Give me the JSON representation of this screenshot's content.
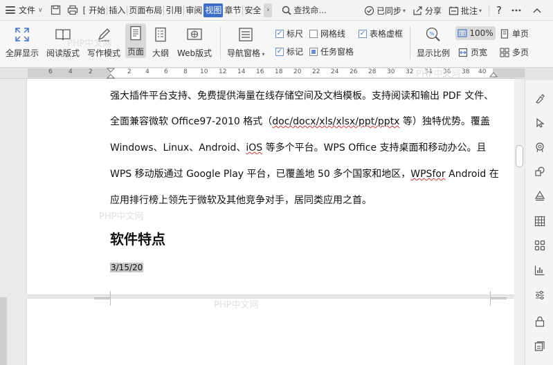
{
  "menu": {
    "file_label": "文件",
    "tabs": [
      "[",
      "开始",
      "插入",
      "页面布局",
      "引用",
      "审阅",
      "视图",
      "章节",
      "安全"
    ],
    "active_tab": "视图",
    "search_label": "查找命...",
    "sync_label": "已同步",
    "share_label": "分享",
    "comment_label": "批注",
    "help_label": "?"
  },
  "ribbon": {
    "fullscreen": "全屏显示",
    "read_mode": "阅读版式",
    "write_mode": "写作模式",
    "page_view": "页面",
    "outline": "大纲",
    "web_view": "Web版式",
    "nav_pane": "导航窗格",
    "ruler": "标尺",
    "gridlines": "网格线",
    "table_lines": "表格虚框",
    "marks": "标记",
    "task_pane": "任务窗格",
    "zoom_ratio": "显示比例",
    "zoom_value": "100%",
    "page_width": "页宽",
    "single_page": "单页",
    "multi_page": "多页"
  },
  "ruler_numbers": [
    "6",
    "4",
    "2",
    "2",
    "4",
    "6",
    "8",
    "10",
    "12",
    "14",
    "16",
    "18",
    "20",
    "22",
    "24",
    "26",
    "28",
    "30",
    "32",
    "34",
    "36",
    "38",
    "40"
  ],
  "document": {
    "lines": [
      "强大插件平台支持、免费提供海量在线存储空间及文档模板。支持阅读和输出 PDF 文件、",
      "全面兼容微软 Office97-2010 格式（doc/docx/xls/xlsx/ppt/pptx 等）独特优势。覆盖",
      "Windows、Linux、Android、iOS 等多个平台。WPS Office 支持桌面和移动办公。且",
      "WPS 移动版通过 Google Play 平台，已覆盖地 50 多个国家和地区，WPSfor Android 在",
      "应用排行榜上领先于微软及其他竞争对手，居同类应用之首。"
    ],
    "heading": "软件特点",
    "date": "3/15/20"
  },
  "watermark": "PHP中文网",
  "colors": {
    "accent": "#3c6ecc",
    "checkbox": "#6b8fd3"
  }
}
